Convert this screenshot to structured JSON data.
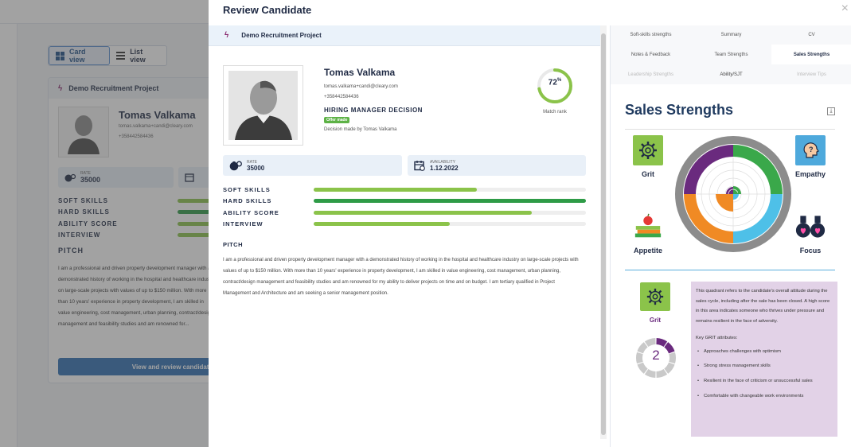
{
  "background": {
    "view_toggle": {
      "card_view": "Card view",
      "list_view": "List view"
    },
    "card": {
      "project": "Demo Recruitment Project",
      "name": "Tomas Valkama",
      "email": "tomas.valkama+candi@cleary.com",
      "phone": "+358442584436",
      "rate_label": "RATE",
      "rate_value": "35000",
      "scores": [
        {
          "label": "SOFT SKILLS",
          "color": "#8bc34a"
        },
        {
          "label": "HARD SKILLS",
          "color": "#2e9b47"
        },
        {
          "label": "ABILITY SCORE",
          "color": "#8bc34a"
        },
        {
          "label": "INTERVIEW",
          "color": "#8bc34a"
        }
      ],
      "pitch_heading": "PITCH",
      "pitch": "I am a professional and driven property development manager with a demonstrated history of working in the hospital and healthcare industry on large-scale projects with values of up to $150 million. With more than 10 years' experience in property development, I am skilled in value engineering, cost management, urban planning, contract/design management and feasibility studies and am renowned for...",
      "button": "View and review candidate"
    }
  },
  "modal": {
    "title": "Review Candidate",
    "close": "×",
    "project": "Demo Recruitment Project",
    "candidate": {
      "name": "Tomas Valkama",
      "email": "tomas.valkama+candi@cleary.com",
      "phone": "+358442584436",
      "hm_decision": "HIRING MANAGER DECISION",
      "offer_badge": "Offer made",
      "decision_by": "Decision made by Tomas Valkama",
      "match_value": 72,
      "match_display": "72",
      "match_unit": "%",
      "match_label": "Match rank"
    },
    "rate": {
      "label": "RATE",
      "value": "35000"
    },
    "availability": {
      "label": "AVAILABILITY",
      "value": "1.12.2022"
    },
    "scores": [
      {
        "label": "SOFT SKILLS",
        "value": 0.6,
        "color": "#8bc34a"
      },
      {
        "label": "HARD SKILLS",
        "value": 1.0,
        "color": "#2e9b47"
      },
      {
        "label": "ABILITY SCORE",
        "value": 0.8,
        "color": "#8bc34a"
      },
      {
        "label": "INTERVIEW",
        "value": 0.5,
        "color": "#8bc34a"
      }
    ],
    "pitch_heading": "PITCH",
    "pitch": "I am a professional and driven property development manager with a demonstrated history of working in the hospital and healthcare industry on large-scale projects with values of up to $150 million. With more than 10 years' experience in property development, I am skilled in value engineering, cost management, urban planning, contract/design management and feasibility studies and am renowned for my ability to deliver projects on time and on budget. I am tertiary qualified in Project Management and Architecture and am seeking a senior management position."
  },
  "right_panel": {
    "tabs": [
      {
        "label": "Soft-skills strengths",
        "state": "normal"
      },
      {
        "label": "Summary",
        "state": "normal"
      },
      {
        "label": "CV",
        "state": "normal"
      },
      {
        "label": "Notes & Feedback",
        "state": "normal"
      },
      {
        "label": "Team Strengths",
        "state": "normal"
      },
      {
        "label": "Sales Strengths",
        "state": "active"
      },
      {
        "label": "Leadership Strengths",
        "state": "faded"
      },
      {
        "label": "Ability/SJT",
        "state": "mid"
      },
      {
        "label": "Interview Tips",
        "state": "faded"
      }
    ],
    "title": "Sales Strengths",
    "traits": [
      "Grit",
      "Empathy",
      "Appetite",
      "Focus"
    ],
    "colors": {
      "grit": "#6a2a7e",
      "empathy": "#3aa84a",
      "appetite": "#f08a24",
      "focus": "#4ec0e8",
      "outer_ring": "#8c8c8c"
    },
    "selected_trait": "Grit",
    "selected_score": "2",
    "description": "This quadrant refers to the candidate's overall attitude during the sales cycle, including after the sale has been closed. A high score in this area indicates someone who thrives under pressure and remains resilient in the face of adversity.",
    "key_heading": "Key GRIT attributes:",
    "attributes": [
      "Approaches challenges with optimism",
      "Strong stress management skills",
      "Resilient in the face of criticism or unsuccessful sales",
      "Comfortable with changeable work environments"
    ]
  }
}
